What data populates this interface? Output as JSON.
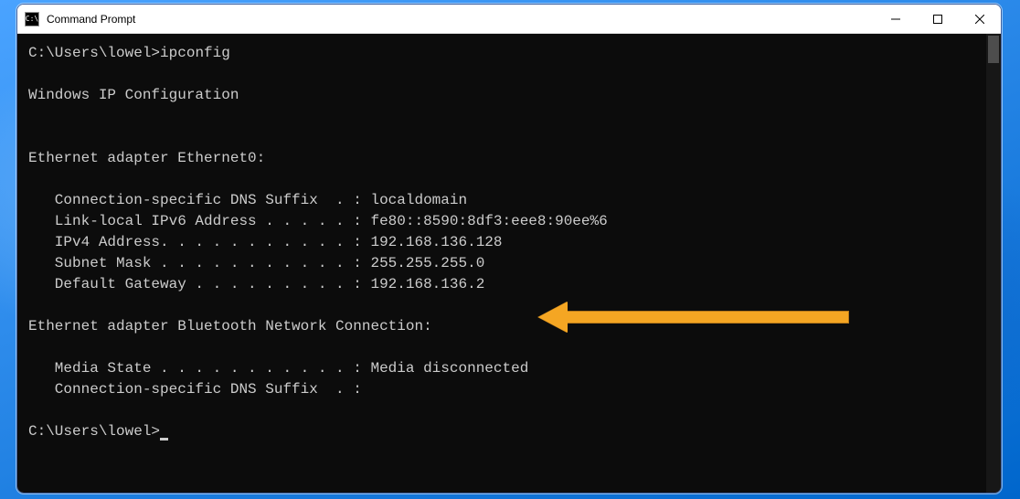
{
  "window": {
    "title": "Command Prompt",
    "icon_label": "cmd-icon"
  },
  "terminal": {
    "prompt1": "C:\\Users\\lowel>",
    "command1": "ipconfig",
    "header": "Windows IP Configuration",
    "adapter1_name": "Ethernet adapter Ethernet0:",
    "adapter1": {
      "dns_label": "   Connection-specific DNS Suffix  . : ",
      "dns_value": "localdomain",
      "ipv6_label": "   Link-local IPv6 Address . . . . . : ",
      "ipv6_value": "fe80::8590:8df3:eee8:90ee%6",
      "ipv4_label": "   IPv4 Address. . . . . . . . . . . : ",
      "ipv4_value": "192.168.136.128",
      "mask_label": "   Subnet Mask . . . . . . . . . . . : ",
      "mask_value": "255.255.255.0",
      "gw_label": "   Default Gateway . . . . . . . . . : ",
      "gw_value": "192.168.136.2"
    },
    "adapter2_name": "Ethernet adapter Bluetooth Network Connection:",
    "adapter2": {
      "media_label": "   Media State . . . . . . . . . . . : ",
      "media_value": "Media disconnected",
      "dns_label": "   Connection-specific DNS Suffix  . :",
      "dns_value": ""
    },
    "prompt2": "C:\\Users\\lowel>"
  }
}
